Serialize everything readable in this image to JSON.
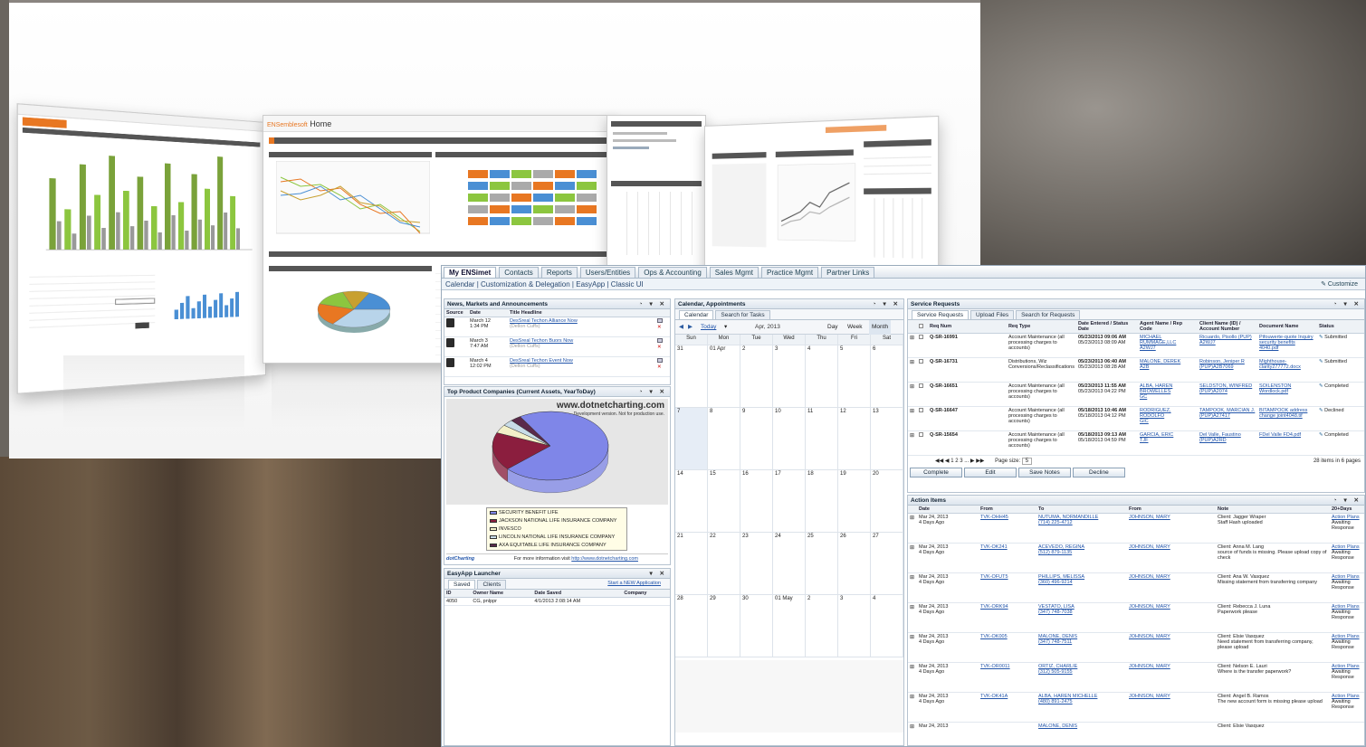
{
  "promo": {
    "center_title": "Home",
    "chart_colors": {
      "orange": "#e87722",
      "green": "#8cc63f",
      "blue": "#4a8fd4",
      "dark": "#555555"
    }
  },
  "app": {
    "tabs": [
      "My ENSimet",
      "Contacts",
      "Reports",
      "Users/Entities",
      "Ops & Accounting",
      "Sales Mgmt",
      "Practice Mgmt",
      "Partner Links"
    ],
    "subnav": "Calendar | Customization & Delegation | EasyApp | Classic UI",
    "customize": "Customize"
  },
  "news": {
    "title": "News, Markets and Announcements",
    "headers": [
      "Source",
      "Date",
      "Title Headline"
    ],
    "rows": [
      {
        "date": "March 12",
        "time": "1:34 PM",
        "title": "DesSreal Techon Alliance Now",
        "sub": "(Dellon Cuffs)"
      },
      {
        "date": "March 3",
        "time": "7:47 AM",
        "title": "DesSreal Techon Buors Now",
        "sub": "(Dellon Cuffs)"
      },
      {
        "date": "March 4",
        "time": "12:02 PM",
        "title": "DesSreal Techon Event Now",
        "sub": "(Dellon Cuffs)"
      }
    ]
  },
  "top_product": {
    "title": "Top Product Companies (Current Assets, YearToDay)",
    "watermark": "www.dotnetcharting.com",
    "watermark_sub": "Development version. Not for production use.",
    "footer_brand": "dotCharting",
    "footer_text": "For more information visit",
    "footer_link": "http://www.dotnetcharting.com"
  },
  "chart_data": {
    "type": "pie",
    "title": "Top Product Companies (Current Assets, YearToDay)",
    "categories": [
      "SECURITY BENEFIT LIFE",
      "JACKSON NATIONAL LIFE INSURANCE COMPANY",
      "INVESCO",
      "LINCOLN NATIONAL LIFE INSURANCE COMPANY",
      "AXA EQUITABLE LIFE INSURANCE COMPANY"
    ],
    "values": [
      72,
      18,
      4,
      3,
      3
    ],
    "colors": [
      "#7f86e8",
      "#8b1e3e",
      "#f3f0c8",
      "#c8dce8",
      "#5a2a4a"
    ],
    "legend_position": "bottom"
  },
  "easyapp": {
    "title": "EasyApp Launcher",
    "tabs": [
      "Saved",
      "Clients"
    ],
    "start_link": "Start a NEW Application",
    "headers": [
      "ID",
      "Owner Name",
      "Date Saved",
      "Company"
    ],
    "rows": [
      {
        "id": "4050",
        "owner": "CG, pnlppr",
        "date": "4/1/2013 2:08:14 AM",
        "company": ""
      }
    ]
  },
  "calendar": {
    "title": "Calendar, Appointments",
    "tabs": [
      "Calendar",
      "Search for Tasks"
    ],
    "today": "Today",
    "month_label": "Apr, 2013",
    "views": [
      "Day",
      "Week",
      "Month"
    ],
    "weekdays": [
      "Sun",
      "Mon",
      "Tue",
      "Wed",
      "Thu",
      "Fri",
      "Sat"
    ],
    "weeks": [
      [
        "31",
        "01 Apr",
        "2",
        "3",
        "4",
        "5",
        "6"
      ],
      [
        "7",
        "8",
        "9",
        "10",
        "11",
        "12",
        "13"
      ],
      [
        "14",
        "15",
        "16",
        "17",
        "18",
        "19",
        "20"
      ],
      [
        "21",
        "22",
        "23",
        "24",
        "25",
        "26",
        "27"
      ],
      [
        "28",
        "29",
        "30",
        "01 May",
        "2",
        "3",
        "4"
      ]
    ]
  },
  "service": {
    "title": "Service Requests",
    "tabs": [
      "Service Requests",
      "Upload Files",
      "Search for Requests"
    ],
    "headers": [
      "Req Num",
      "Req Type",
      "Date Entered / Status Date",
      "Agent Name / Rep Code",
      "Client Name (ID) / Account Number",
      "Document Name",
      "Status"
    ],
    "rows": [
      {
        "num": "Q-SR-16991",
        "type": "Account Maintenance (all processing charges to accounts)",
        "date": "05/23/2013 09:06 AM",
        "date2": "05/23/2013 08:09 AM",
        "agent": "MICHAEL RUMMAGE,LLC",
        "code": "A2WJ7",
        "client": "Ricuardo, Pisollo (PUP)",
        "acct": "A2WJ7",
        "doc": "Pifouwerte-quote Inquiry security benefits 4040.pdf",
        "status": "Submitted"
      },
      {
        "num": "Q-SR-16731",
        "type": "Distributions, Wiz Conversions/Reclassifications",
        "date": "05/23/2013 06:40 AM",
        "date2": "05/23/2013 08:28 AM",
        "agent": "MALONE, DEREK",
        "code": "A2B",
        "client": "Robinson, Jeniper R (PUP)A2B7069",
        "acct": "",
        "doc": "Mighthouse-clarity277772.docx",
        "status": "Submitted"
      },
      {
        "num": "Q-SR-16651",
        "type": "Account Maintenance (all processing charges to accounts)",
        "date": "05/23/2013 11:55 AM",
        "date2": "05/23/2013 04:22 PM",
        "agent": "ALBA, HAREN BROWELLES",
        "code": "GC",
        "client": "SELDSTON, WINFRED (PUP)A2074",
        "acct": "",
        "doc": "SOILENSTON Wordlock.pdf",
        "status": "Completed"
      },
      {
        "num": "Q-SR-16647",
        "type": "Account Maintenance (all processing charges to accounts)",
        "date": "05/18/2013 10:46 AM",
        "date2": "05/18/2013 04:12 PM",
        "agent": "RODRIGUEZ, RODOLFO",
        "code": "GIC",
        "client": "TAMPOOK, MARCIAN J. (PUP)A27417",
        "acct": "",
        "doc": "BITAMPOOK address change joint4048.tif",
        "status": "Declined"
      },
      {
        "num": "Q-SR-15654",
        "type": "Account Maintenance (all processing charges to accounts)",
        "date": "05/18/2013 09:13 AM",
        "date2": "05/18/2013 04:59 PM",
        "agent": "GARCIA, ERIC",
        "code": "TJF",
        "client": "Del Valle, Faustino (PUP)A2RD",
        "acct": "",
        "doc": "FDel Valle FD4.pdf",
        "status": "Completed"
      }
    ],
    "pager": "1  2  3 ...",
    "page_size_label": "Page size:",
    "page_size": "5",
    "items_info": "28 items in 6 pages",
    "buttons": [
      "Complete",
      "Edit",
      "Save Notes",
      "Decline"
    ]
  },
  "action": {
    "title": "Action Items",
    "headers": [
      "Date",
      "From",
      "To",
      "From",
      "Note",
      "20+Days"
    ],
    "rows": [
      {
        "date": "Mar 24, 2013",
        "ago": "4 Days Ago",
        "from": "TVK-OHH45",
        "to": "NUTUMA, NORMANDILLE",
        "tophone": "(714) 225-4712",
        "assignee": "JOHNSON, MARY",
        "note": "Client: Jagger Wraper",
        "note2": "Staff Hash uploaded",
        "status": "Action Plans",
        "status2": "Awaiting Response"
      },
      {
        "date": "Mar 24, 2013",
        "ago": "4 Days Ago",
        "from": "TVK-OK241",
        "to": "ACEVEDO, REGINA",
        "tophone": "(512) 879-1135",
        "assignee": "JOHNSON, MARY",
        "note": "Client: Anna M. Lang",
        "note2": "source of funds is missing. Please upload copy of check",
        "status": "Action Plans",
        "status2": "Awaiting Response"
      },
      {
        "date": "Mar 24, 2013",
        "ago": "4 Days Ago",
        "from": "TVK-OFUT5",
        "to": "PHILLIPS, MELISSA",
        "tophone": "(360) 496-9214",
        "assignee": "JOHNSON, MARY",
        "note": "Client: Ana W. Vasquez",
        "note2": "Missing statement from transferring company",
        "status": "Action Plans",
        "status2": "Awaiting Response"
      },
      {
        "date": "Mar 24, 2013",
        "ago": "4 Days Ago",
        "from": "TVK-ORK94",
        "to": "VESTATO, LISA",
        "tophone": "(347) 748-7038",
        "assignee": "JOHNSON, MARY",
        "note": "Client: Rebecca J. Luna",
        "note2": "Paperwork please",
        "status": "Action Plans",
        "status2": "Awaiting Response"
      },
      {
        "date": "Mar 24, 2013",
        "ago": "4 Days Ago",
        "from": "TVK-OK005",
        "to": "MALONE, DENIS",
        "tophone": "(347) 748-7511",
        "assignee": "JOHNSON, MARY",
        "note": "Client: Elsie Vasquez",
        "note2": "Need statement from transferring company, please upload",
        "status": "Action Plans",
        "status2": "Awaiting Response"
      },
      {
        "date": "Mar 24, 2013",
        "ago": "4 Days Ago",
        "from": "TVK-OR0011",
        "to": "ORTIZ, CHARLIE",
        "tophone": "(312) 505-9155",
        "assignee": "JOHNSON, MARY",
        "note": "Client: Nelson E. Lauri",
        "note2": "Where is the transfer paperwork?",
        "status": "Action Plans",
        "status2": "Awaiting Response"
      },
      {
        "date": "Mar 24, 2013",
        "ago": "4 Days Ago",
        "from": "TVK-OK41A",
        "to": "ALBA, HAREN MICHELLE",
        "tophone": "(480) 891-2475",
        "assignee": "JOHNSON, MARY",
        "note": "Client: Angel B. Ramos",
        "note2": "The new account form is missing please upload",
        "status": "Action Plans",
        "status2": "Awaiting Response"
      },
      {
        "date": "Mar 24, 2013",
        "ago": "",
        "from": "",
        "to": "MALONE, DENIS",
        "tophone": "",
        "assignee": "",
        "note": "Client: Elsie Vasquez",
        "note2": "",
        "status": "",
        "status2": ""
      }
    ]
  }
}
